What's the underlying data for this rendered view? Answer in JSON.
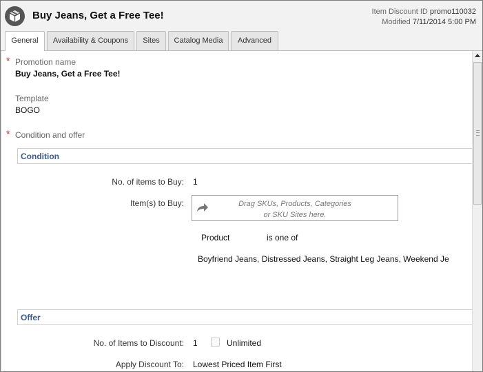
{
  "header": {
    "title": "Buy Jeans, Get a Free Tee!",
    "id_label": "Item Discount ID",
    "id_value": "promo110032",
    "modified_label": "Modified",
    "modified_value": "7/11/2014 5:00 PM"
  },
  "tabs": [
    {
      "label": "General",
      "active": true
    },
    {
      "label": "Availability & Coupons",
      "active": false
    },
    {
      "label": "Sites",
      "active": false
    },
    {
      "label": "Catalog Media",
      "active": false
    },
    {
      "label": "Advanced",
      "active": false
    }
  ],
  "form": {
    "required_mark": "*",
    "promotion_name_label": "Promotion name",
    "promotion_name_value": "Buy Jeans, Get a Free Tee!",
    "template_label": "Template",
    "template_value": "BOGO",
    "condition_offer_label": "Condition and offer"
  },
  "condition": {
    "heading": "Condition",
    "items_to_buy_label": "No. of items to Buy:",
    "items_to_buy_value": "1",
    "items_label": "Item(s) to Buy:",
    "drop_hint_line1": "Drag SKUs, Products, Categories",
    "drop_hint_line2": "or SKU Sites here.",
    "rule_subject": "Product",
    "rule_operator": "is one of",
    "rule_values": "Boyfriend Jeans, Distressed Jeans, Straight Leg Jeans, Weekend Je"
  },
  "offer": {
    "heading": "Offer",
    "items_to_discount_label": "No. of Items to Discount:",
    "items_to_discount_value": "1",
    "unlimited_label": "Unlimited",
    "unlimited_checked": false,
    "apply_to_label": "Apply Discount To:",
    "apply_to_value": "Lowest Priced Item First"
  },
  "icons": {
    "logo": "package-box-icon",
    "drop_arrow": "share-arrow-icon"
  },
  "colors": {
    "section_heading": "#3c5a8a",
    "required": "#cc2222"
  }
}
